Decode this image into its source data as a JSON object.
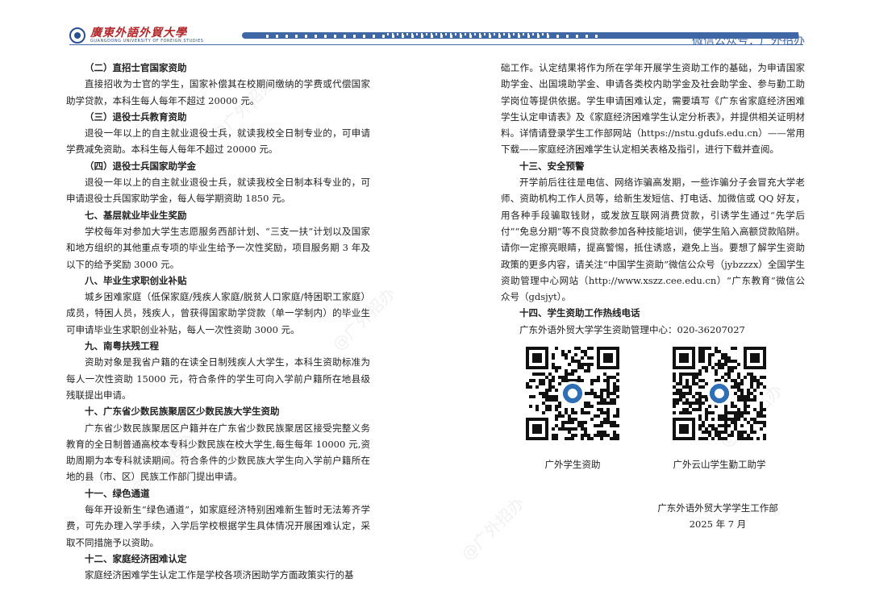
{
  "header": {
    "logo_text": "廣東外語外貿大學",
    "logo_subtext": "GUANGDONG UNIVERSITY OF FOREIGN STUDIES",
    "wechat": "微信公众号：广外招办"
  },
  "watermark": "@广外招办",
  "left": {
    "s1_title": "（二）直招士官国家资助",
    "s1_body": "直接招收为士官的学生，国家补偿其在校期间缴纳的学费或代偿国家助学贷款，本科生每人每年不超过 20000 元。",
    "s2_title": "（三）退役士兵教育资助",
    "s2_body": "退役一年以上的自主就业退役士兵，就读我校全日制专业的，可申请学费减免资助。本科生每人每年不超过 20000 元。",
    "s3_title": "（四）退役士兵国家助学金",
    "s3_body": "退役一年以上的自主就业退役士兵，就读我校全日制本科专业的，可申请退役士兵国家助学金，每人每学期资助 1850 元。",
    "s4_title": "七、基层就业毕业生奖励",
    "s4_body": "学校每年对参加大学生志愿服务西部计划、“三支一扶”计划以及国家和地方组织的其他重点专项的毕业生给予一次性奖励，项目服务期 3 年及以下的给予奖励 3000 元。",
    "s5_title": "八、毕业生求职创业补贴",
    "s5_body": "城乡困难家庭（低保家庭/残疾人家庭/脱贫人口家庭/特困职工家庭）成员，特困人员，残疾人，曾获得国家助学贷款（单一学制内）的毕业生可申请毕业生求职创业补贴，每人一次性资助 3000 元。",
    "s6_title": "九、南粤扶残工程",
    "s6_body": "资助对象是我省户籍的在读全日制残疾人大学生，本科生资助标准为每人一次性资助 15000 元，符合条件的学生可向入学前户籍所在地县级残联提出申请。",
    "s7_title": "十、广东省少数民族聚居区少数民族大学生资助",
    "s7_body": "广东省少数民族聚居区户籍并在广东省少数民族聚居区接受完整义务教育的全日制普通高校本专科少数民族在校大学生,每生每年 10000 元,资助周期为本专科就读期间。符合条件的少数民族大学生向入学前户籍所在地的县（市、区）民族工作部门提出申请。",
    "s8_title": "十一、绿色通道",
    "s8_body": "每年开设新生“绿色通道”，如家庭经济特别困难新生暂时无法筹齐学费，可先办理入学手续，入学后学校根据学生具体情况开展困难认定，采取不同措施予以资助。",
    "s9_title": "十二、家庭经济困难认定",
    "s9_body": "家庭经济困难学生认定工作是学校各项济困助学方面政策实行的基"
  },
  "right": {
    "cont_body": "础工作。认定结果将作为所在学年开展学生资助工作的基础，为申请国家助学金、出国境助学金、申请各类校内助学金及社会助学金、参与勤工助学岗位等提供依据。学生申请困难认定，需要填写《广东省家庭经济困难学生认定申请表》及《家庭经济困难学生认定分析表》，并提供相关证明材料。详情请登录学生工作部网站（https://nstu.gdufs.edu.cn）——常用下载——家庭经济困难学生认定相关表格及指引，进行下载并查阅。",
    "s13_title": "十三、安全预警",
    "s13_body": "开学前后往往是电信、网络诈骗高发期，一些诈骗分子会冒充大学老师、资助机构工作人员等，给新生发短信、打电话、加微信或 QQ 好友，用各种手段骗取钱财，或发放互联网消费贷款，引诱学生通过“先学后付”“免息分期”等不良贷款参加各种技能培训，使学生陷入高额贷款陷阱。请你一定擦亮眼睛，提高警惕，抵住诱惑，避免上当。要想了解学生资助政策的更多内容，请关注“中国学生资助”微信公众号（jybzzzx）全国学生资助管理中心网站（http://www.xszz.cee.edu.cn）“广东教育”微信公众号（gdsjyt）。",
    "s14_title": "十四、学生资助工作热线电话",
    "hotline": "广东外语外贸大学学生资助管理中心：020-36207027",
    "qr1_label": "广外学生资助",
    "qr2_label": "广外云山学生勤工助学",
    "sign_org": "广东外语外贸大学学生工作部",
    "sign_date": "2025 年 7 月"
  },
  "colors": {
    "accent": "#3f66a5",
    "logo": "#b3262a"
  }
}
